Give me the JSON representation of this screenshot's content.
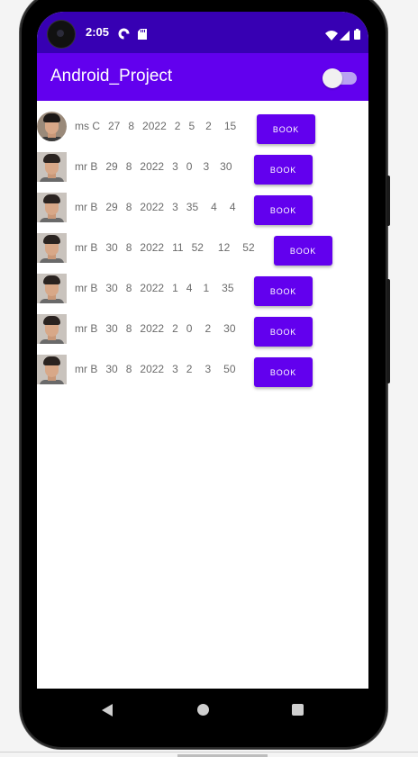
{
  "status_bar": {
    "time": "2:05",
    "icons": [
      "pocket-casts-icon",
      "sd-card-icon",
      "wifi-icon",
      "signal-icon",
      "battery-icon"
    ]
  },
  "app_bar": {
    "title": "Android_Project",
    "toggle_on": false
  },
  "colors": {
    "primary": "#6200ee",
    "primary_dark": "#3700b3",
    "button_text": "#ffffff",
    "row_text": "#6b6b6b"
  },
  "rows": [
    {
      "name": "ms C",
      "day": "27",
      "month": "8",
      "year": "2022",
      "v1": "2",
      "v2": "5",
      "v3": "2",
      "v4": "15",
      "button": "BOOK",
      "avatar": "avatar-photo-round"
    },
    {
      "name": "mr B",
      "day": "29",
      "month": "8",
      "year": "2022",
      "v1": "3",
      "v2": "0",
      "v3": "3",
      "v4": "30",
      "button": "BOOK",
      "avatar": "avatar-photo"
    },
    {
      "name": "mr B",
      "day": "29",
      "month": "8",
      "year": "2022",
      "v1": "3",
      "v2": "35",
      "v3": "4",
      "v4": "4",
      "button": "BOOK",
      "avatar": "avatar-photo"
    },
    {
      "name": "mr B",
      "day": "30",
      "month": "8",
      "year": "2022",
      "v1": "11",
      "v2": "52",
      "v3": "12",
      "v4": "52",
      "button": "BOOK",
      "avatar": "avatar-photo"
    },
    {
      "name": "mr B",
      "day": "30",
      "month": "8",
      "year": "2022",
      "v1": "1",
      "v2": "4",
      "v3": "1",
      "v4": "35",
      "button": "BOOK",
      "avatar": "avatar-photo"
    },
    {
      "name": "mr B",
      "day": "30",
      "month": "8",
      "year": "2022",
      "v1": "2",
      "v2": "0",
      "v3": "2",
      "v4": "30",
      "button": "BOOK",
      "avatar": "avatar-photo"
    },
    {
      "name": "mr B",
      "day": "30",
      "month": "8",
      "year": "2022",
      "v1": "3",
      "v2": "2",
      "v3": "3",
      "v4": "50",
      "button": "BOOK",
      "avatar": "avatar-photo"
    }
  ],
  "nav_bar": {
    "icons": [
      "back-icon",
      "home-icon",
      "recents-icon"
    ]
  }
}
